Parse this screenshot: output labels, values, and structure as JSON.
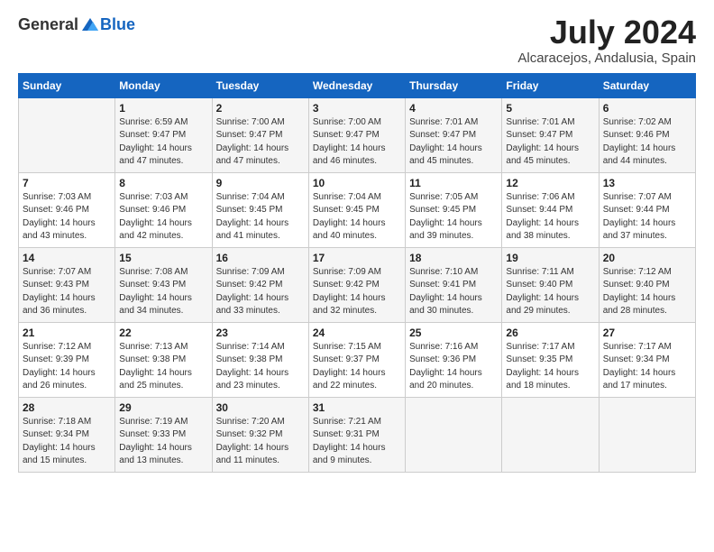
{
  "logo": {
    "text_general": "General",
    "text_blue": "Blue"
  },
  "header": {
    "month_year": "July 2024",
    "location": "Alcaracejos, Andalusia, Spain"
  },
  "columns": [
    "Sunday",
    "Monday",
    "Tuesday",
    "Wednesday",
    "Thursday",
    "Friday",
    "Saturday"
  ],
  "weeks": [
    [
      {
        "day": "",
        "info": ""
      },
      {
        "day": "1",
        "info": "Sunrise: 6:59 AM\nSunset: 9:47 PM\nDaylight: 14 hours\nand 47 minutes."
      },
      {
        "day": "2",
        "info": "Sunrise: 7:00 AM\nSunset: 9:47 PM\nDaylight: 14 hours\nand 47 minutes."
      },
      {
        "day": "3",
        "info": "Sunrise: 7:00 AM\nSunset: 9:47 PM\nDaylight: 14 hours\nand 46 minutes."
      },
      {
        "day": "4",
        "info": "Sunrise: 7:01 AM\nSunset: 9:47 PM\nDaylight: 14 hours\nand 45 minutes."
      },
      {
        "day": "5",
        "info": "Sunrise: 7:01 AM\nSunset: 9:47 PM\nDaylight: 14 hours\nand 45 minutes."
      },
      {
        "day": "6",
        "info": "Sunrise: 7:02 AM\nSunset: 9:46 PM\nDaylight: 14 hours\nand 44 minutes."
      }
    ],
    [
      {
        "day": "7",
        "info": "Sunrise: 7:03 AM\nSunset: 9:46 PM\nDaylight: 14 hours\nand 43 minutes."
      },
      {
        "day": "8",
        "info": "Sunrise: 7:03 AM\nSunset: 9:46 PM\nDaylight: 14 hours\nand 42 minutes."
      },
      {
        "day": "9",
        "info": "Sunrise: 7:04 AM\nSunset: 9:45 PM\nDaylight: 14 hours\nand 41 minutes."
      },
      {
        "day": "10",
        "info": "Sunrise: 7:04 AM\nSunset: 9:45 PM\nDaylight: 14 hours\nand 40 minutes."
      },
      {
        "day": "11",
        "info": "Sunrise: 7:05 AM\nSunset: 9:45 PM\nDaylight: 14 hours\nand 39 minutes."
      },
      {
        "day": "12",
        "info": "Sunrise: 7:06 AM\nSunset: 9:44 PM\nDaylight: 14 hours\nand 38 minutes."
      },
      {
        "day": "13",
        "info": "Sunrise: 7:07 AM\nSunset: 9:44 PM\nDaylight: 14 hours\nand 37 minutes."
      }
    ],
    [
      {
        "day": "14",
        "info": "Sunrise: 7:07 AM\nSunset: 9:43 PM\nDaylight: 14 hours\nand 36 minutes."
      },
      {
        "day": "15",
        "info": "Sunrise: 7:08 AM\nSunset: 9:43 PM\nDaylight: 14 hours\nand 34 minutes."
      },
      {
        "day": "16",
        "info": "Sunrise: 7:09 AM\nSunset: 9:42 PM\nDaylight: 14 hours\nand 33 minutes."
      },
      {
        "day": "17",
        "info": "Sunrise: 7:09 AM\nSunset: 9:42 PM\nDaylight: 14 hours\nand 32 minutes."
      },
      {
        "day": "18",
        "info": "Sunrise: 7:10 AM\nSunset: 9:41 PM\nDaylight: 14 hours\nand 30 minutes."
      },
      {
        "day": "19",
        "info": "Sunrise: 7:11 AM\nSunset: 9:40 PM\nDaylight: 14 hours\nand 29 minutes."
      },
      {
        "day": "20",
        "info": "Sunrise: 7:12 AM\nSunset: 9:40 PM\nDaylight: 14 hours\nand 28 minutes."
      }
    ],
    [
      {
        "day": "21",
        "info": "Sunrise: 7:12 AM\nSunset: 9:39 PM\nDaylight: 14 hours\nand 26 minutes."
      },
      {
        "day": "22",
        "info": "Sunrise: 7:13 AM\nSunset: 9:38 PM\nDaylight: 14 hours\nand 25 minutes."
      },
      {
        "day": "23",
        "info": "Sunrise: 7:14 AM\nSunset: 9:38 PM\nDaylight: 14 hours\nand 23 minutes."
      },
      {
        "day": "24",
        "info": "Sunrise: 7:15 AM\nSunset: 9:37 PM\nDaylight: 14 hours\nand 22 minutes."
      },
      {
        "day": "25",
        "info": "Sunrise: 7:16 AM\nSunset: 9:36 PM\nDaylight: 14 hours\nand 20 minutes."
      },
      {
        "day": "26",
        "info": "Sunrise: 7:17 AM\nSunset: 9:35 PM\nDaylight: 14 hours\nand 18 minutes."
      },
      {
        "day": "27",
        "info": "Sunrise: 7:17 AM\nSunset: 9:34 PM\nDaylight: 14 hours\nand 17 minutes."
      }
    ],
    [
      {
        "day": "28",
        "info": "Sunrise: 7:18 AM\nSunset: 9:34 PM\nDaylight: 14 hours\nand 15 minutes."
      },
      {
        "day": "29",
        "info": "Sunrise: 7:19 AM\nSunset: 9:33 PM\nDaylight: 14 hours\nand 13 minutes."
      },
      {
        "day": "30",
        "info": "Sunrise: 7:20 AM\nSunset: 9:32 PM\nDaylight: 14 hours\nand 11 minutes."
      },
      {
        "day": "31",
        "info": "Sunrise: 7:21 AM\nSunset: 9:31 PM\nDaylight: 14 hours\nand 9 minutes."
      },
      {
        "day": "",
        "info": ""
      },
      {
        "day": "",
        "info": ""
      },
      {
        "day": "",
        "info": ""
      }
    ]
  ]
}
